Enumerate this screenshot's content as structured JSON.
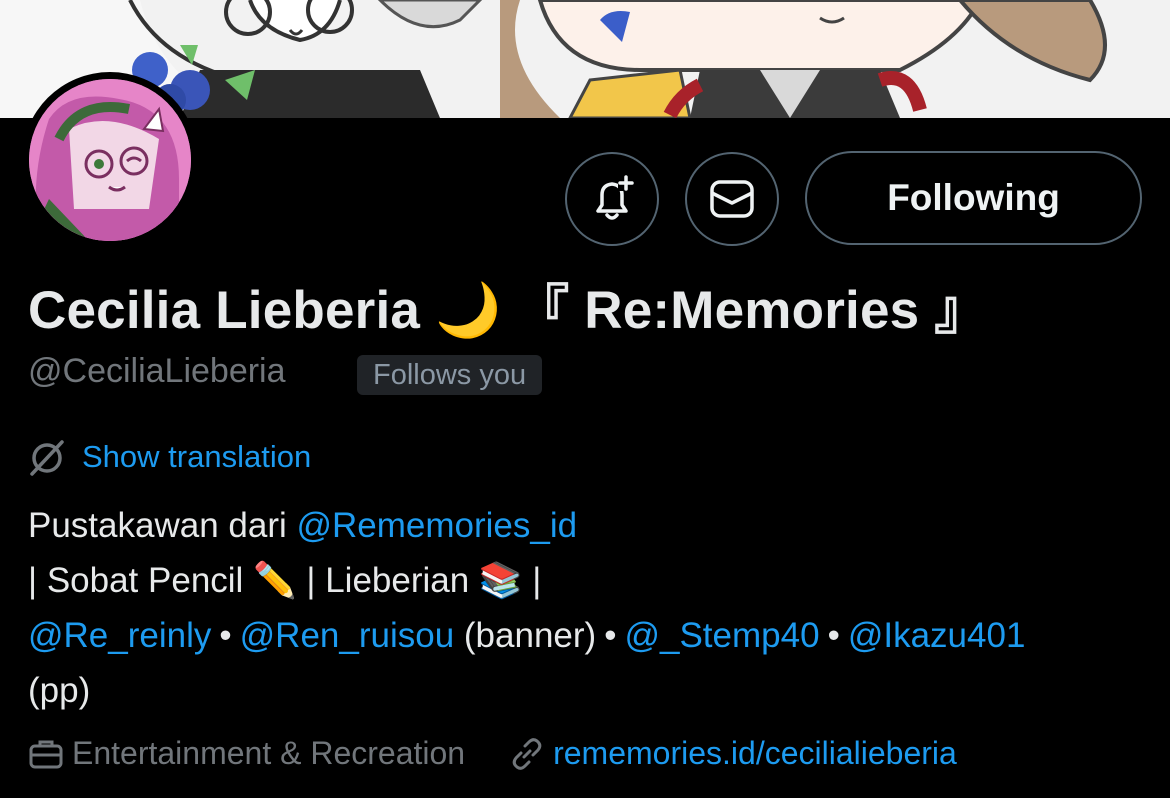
{
  "profile": {
    "display_name": "Cecilia Lieberia",
    "name_emoji": "🌙",
    "name_suffix": "『 Re:Memories 』",
    "handle": "@CeciliaLieberia",
    "follows_you_label": "Follows you"
  },
  "actions": {
    "notify_icon": "bell-plus-icon",
    "message_icon": "envelope-icon",
    "following_label": "Following"
  },
  "translation": {
    "icon": "globe-slash-icon",
    "label": "Show translation"
  },
  "bio": {
    "line1_text": "Pustakawan dari ",
    "line1_mention": "@Rememories_id",
    "line2_a": "| Sobat Pencil ",
    "line2_emoji1": "✏️",
    "line2_b": " | Lieberian ",
    "line2_emoji2": "📚",
    "line2_c": " |",
    "mention1": "@Re_reinly",
    "mention2": "@Ren_ruisou",
    "banner_note": " (banner)",
    "mention3": "@_Stemp40",
    "mention4": "@Ikazu401",
    "separator": "•",
    "line4": "(pp)"
  },
  "meta": {
    "category_icon": "briefcase-icon",
    "category": "Entertainment & Recreation",
    "link_icon": "link-icon",
    "website": "rememories.id/cecilialieberia"
  },
  "colors": {
    "background": "#000000",
    "accent": "#1d9bf0",
    "muted": "#71767b",
    "border": "#536471",
    "avatar_pink": "#e685c8"
  }
}
